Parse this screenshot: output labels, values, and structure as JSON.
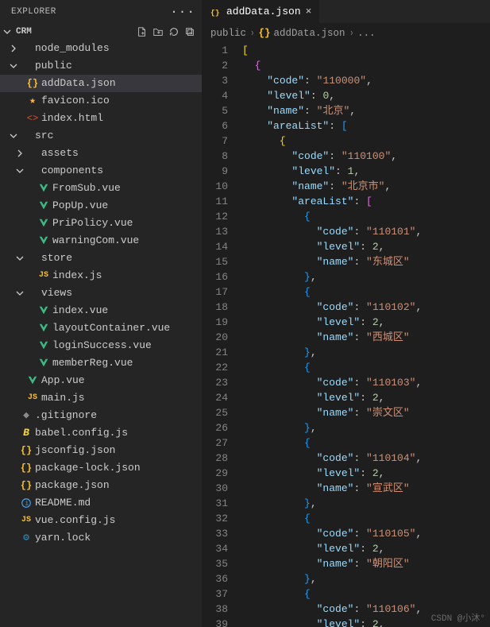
{
  "sidebar": {
    "title": "EXPLORER",
    "project": "CRM",
    "toolbar": {
      "new_file_icon": "new-file",
      "new_folder_icon": "new-folder",
      "refresh_icon": "refresh",
      "collapse_icon": "collapse-all"
    },
    "tree": [
      {
        "label": "node_modules",
        "type": "folder",
        "open": false,
        "depth": 0
      },
      {
        "label": "public",
        "type": "folder",
        "open": true,
        "depth": 0
      },
      {
        "label": "addData.json",
        "type": "file",
        "icon": "json",
        "depth": 1,
        "active": true
      },
      {
        "label": "favicon.ico",
        "type": "file",
        "icon": "ico",
        "depth": 1
      },
      {
        "label": "index.html",
        "type": "file",
        "icon": "html",
        "depth": 1
      },
      {
        "label": "src",
        "type": "folder",
        "open": true,
        "depth": 0
      },
      {
        "label": "assets",
        "type": "folder",
        "open": false,
        "depth": 1
      },
      {
        "label": "components",
        "type": "folder",
        "open": true,
        "depth": 1
      },
      {
        "label": "FromSub.vue",
        "type": "file",
        "icon": "vue",
        "depth": 2
      },
      {
        "label": "PopUp.vue",
        "type": "file",
        "icon": "vue",
        "depth": 2
      },
      {
        "label": "PriPolicy.vue",
        "type": "file",
        "icon": "vue",
        "depth": 2
      },
      {
        "label": "warningCom.vue",
        "type": "file",
        "icon": "vue",
        "depth": 2
      },
      {
        "label": "store",
        "type": "folder",
        "open": true,
        "depth": 1
      },
      {
        "label": "index.js",
        "type": "file",
        "icon": "js",
        "depth": 2
      },
      {
        "label": "views",
        "type": "folder",
        "open": true,
        "depth": 1
      },
      {
        "label": "index.vue",
        "type": "file",
        "icon": "vue",
        "depth": 2
      },
      {
        "label": "layoutContainer.vue",
        "type": "file",
        "icon": "vue",
        "depth": 2
      },
      {
        "label": "loginSuccess.vue",
        "type": "file",
        "icon": "vue",
        "depth": 2
      },
      {
        "label": "memberReg.vue",
        "type": "file",
        "icon": "vue",
        "depth": 2
      },
      {
        "label": "App.vue",
        "type": "file",
        "icon": "vue",
        "depth": 1
      },
      {
        "label": "main.js",
        "type": "file",
        "icon": "js",
        "depth": 1
      },
      {
        "label": ".gitignore",
        "type": "file",
        "icon": "git",
        "depth": 0
      },
      {
        "label": "babel.config.js",
        "type": "file",
        "icon": "babel",
        "depth": 0
      },
      {
        "label": "jsconfig.json",
        "type": "file",
        "icon": "json",
        "depth": 0
      },
      {
        "label": "package-lock.json",
        "type": "file",
        "icon": "json",
        "depth": 0
      },
      {
        "label": "package.json",
        "type": "file",
        "icon": "json",
        "depth": 0
      },
      {
        "label": "README.md",
        "type": "file",
        "icon": "info",
        "depth": 0
      },
      {
        "label": "vue.config.js",
        "type": "file",
        "icon": "js",
        "depth": 0
      },
      {
        "label": "yarn.lock",
        "type": "file",
        "icon": "yarn",
        "depth": 0
      }
    ]
  },
  "editor": {
    "tab": {
      "label": "addData.json",
      "icon": "json"
    },
    "breadcrumb": [
      "public",
      "addData.json",
      "..."
    ],
    "code": [
      [
        {
          "t": "[",
          "c": "bracket"
        }
      ],
      [
        {
          "t": "  "
        },
        {
          "t": "{",
          "c": "bracket-o"
        }
      ],
      [
        {
          "t": "    "
        },
        {
          "t": "\"code\"",
          "c": "key"
        },
        {
          "t": ": ",
          "c": "punc"
        },
        {
          "t": "\"110000\"",
          "c": "string"
        },
        {
          "t": ",",
          "c": "punc"
        }
      ],
      [
        {
          "t": "    "
        },
        {
          "t": "\"level\"",
          "c": "key"
        },
        {
          "t": ": ",
          "c": "punc"
        },
        {
          "t": "0",
          "c": "num"
        },
        {
          "t": ",",
          "c": "punc"
        }
      ],
      [
        {
          "t": "    "
        },
        {
          "t": "\"name\"",
          "c": "key"
        },
        {
          "t": ": ",
          "c": "punc"
        },
        {
          "t": "\"北京\"",
          "c": "string"
        },
        {
          "t": ",",
          "c": "punc"
        }
      ],
      [
        {
          "t": "    "
        },
        {
          "t": "\"areaList\"",
          "c": "key"
        },
        {
          "t": ": ",
          "c": "punc"
        },
        {
          "t": "[",
          "c": "bracket-b"
        }
      ],
      [
        {
          "t": "      "
        },
        {
          "t": "{",
          "c": "bracket"
        }
      ],
      [
        {
          "t": "        "
        },
        {
          "t": "\"code\"",
          "c": "key"
        },
        {
          "t": ": ",
          "c": "punc"
        },
        {
          "t": "\"110100\"",
          "c": "string"
        },
        {
          "t": ",",
          "c": "punc"
        }
      ],
      [
        {
          "t": "        "
        },
        {
          "t": "\"level\"",
          "c": "key"
        },
        {
          "t": ": ",
          "c": "punc"
        },
        {
          "t": "1",
          "c": "num"
        },
        {
          "t": ",",
          "c": "punc"
        }
      ],
      [
        {
          "t": "        "
        },
        {
          "t": "\"name\"",
          "c": "key"
        },
        {
          "t": ": ",
          "c": "punc"
        },
        {
          "t": "\"北京市\"",
          "c": "string"
        },
        {
          "t": ",",
          "c": "punc"
        }
      ],
      [
        {
          "t": "        "
        },
        {
          "t": "\"areaList\"",
          "c": "key"
        },
        {
          "t": ": ",
          "c": "punc"
        },
        {
          "t": "[",
          "c": "bracket-o"
        }
      ],
      [
        {
          "t": "          "
        },
        {
          "t": "{",
          "c": "bracket-b"
        }
      ],
      [
        {
          "t": "            "
        },
        {
          "t": "\"code\"",
          "c": "key"
        },
        {
          "t": ": ",
          "c": "punc"
        },
        {
          "t": "\"110101\"",
          "c": "string"
        },
        {
          "t": ",",
          "c": "punc"
        }
      ],
      [
        {
          "t": "            "
        },
        {
          "t": "\"level\"",
          "c": "key"
        },
        {
          "t": ": ",
          "c": "punc"
        },
        {
          "t": "2",
          "c": "num"
        },
        {
          "t": ",",
          "c": "punc"
        }
      ],
      [
        {
          "t": "            "
        },
        {
          "t": "\"name\"",
          "c": "key"
        },
        {
          "t": ": ",
          "c": "punc"
        },
        {
          "t": "\"东城区\"",
          "c": "string"
        }
      ],
      [
        {
          "t": "          "
        },
        {
          "t": "}",
          "c": "bracket-b"
        },
        {
          "t": ",",
          "c": "punc"
        }
      ],
      [
        {
          "t": "          "
        },
        {
          "t": "{",
          "c": "bracket-b"
        }
      ],
      [
        {
          "t": "            "
        },
        {
          "t": "\"code\"",
          "c": "key"
        },
        {
          "t": ": ",
          "c": "punc"
        },
        {
          "t": "\"110102\"",
          "c": "string"
        },
        {
          "t": ",",
          "c": "punc"
        }
      ],
      [
        {
          "t": "            "
        },
        {
          "t": "\"level\"",
          "c": "key"
        },
        {
          "t": ": ",
          "c": "punc"
        },
        {
          "t": "2",
          "c": "num"
        },
        {
          "t": ",",
          "c": "punc"
        }
      ],
      [
        {
          "t": "            "
        },
        {
          "t": "\"name\"",
          "c": "key"
        },
        {
          "t": ": ",
          "c": "punc"
        },
        {
          "t": "\"西城区\"",
          "c": "string"
        }
      ],
      [
        {
          "t": "          "
        },
        {
          "t": "}",
          "c": "bracket-b"
        },
        {
          "t": ",",
          "c": "punc"
        }
      ],
      [
        {
          "t": "          "
        },
        {
          "t": "{",
          "c": "bracket-b"
        }
      ],
      [
        {
          "t": "            "
        },
        {
          "t": "\"code\"",
          "c": "key"
        },
        {
          "t": ": ",
          "c": "punc"
        },
        {
          "t": "\"110103\"",
          "c": "string"
        },
        {
          "t": ",",
          "c": "punc"
        }
      ],
      [
        {
          "t": "            "
        },
        {
          "t": "\"level\"",
          "c": "key"
        },
        {
          "t": ": ",
          "c": "punc"
        },
        {
          "t": "2",
          "c": "num"
        },
        {
          "t": ",",
          "c": "punc"
        }
      ],
      [
        {
          "t": "            "
        },
        {
          "t": "\"name\"",
          "c": "key"
        },
        {
          "t": ": ",
          "c": "punc"
        },
        {
          "t": "\"崇文区\"",
          "c": "string"
        }
      ],
      [
        {
          "t": "          "
        },
        {
          "t": "}",
          "c": "bracket-b"
        },
        {
          "t": ",",
          "c": "punc"
        }
      ],
      [
        {
          "t": "          "
        },
        {
          "t": "{",
          "c": "bracket-b"
        }
      ],
      [
        {
          "t": "            "
        },
        {
          "t": "\"code\"",
          "c": "key"
        },
        {
          "t": ": ",
          "c": "punc"
        },
        {
          "t": "\"110104\"",
          "c": "string"
        },
        {
          "t": ",",
          "c": "punc"
        }
      ],
      [
        {
          "t": "            "
        },
        {
          "t": "\"level\"",
          "c": "key"
        },
        {
          "t": ": ",
          "c": "punc"
        },
        {
          "t": "2",
          "c": "num"
        },
        {
          "t": ",",
          "c": "punc"
        }
      ],
      [
        {
          "t": "            "
        },
        {
          "t": "\"name\"",
          "c": "key"
        },
        {
          "t": ": ",
          "c": "punc"
        },
        {
          "t": "\"宣武区\"",
          "c": "string"
        }
      ],
      [
        {
          "t": "          "
        },
        {
          "t": "}",
          "c": "bracket-b"
        },
        {
          "t": ",",
          "c": "punc"
        }
      ],
      [
        {
          "t": "          "
        },
        {
          "t": "{",
          "c": "bracket-b"
        }
      ],
      [
        {
          "t": "            "
        },
        {
          "t": "\"code\"",
          "c": "key"
        },
        {
          "t": ": ",
          "c": "punc"
        },
        {
          "t": "\"110105\"",
          "c": "string"
        },
        {
          "t": ",",
          "c": "punc"
        }
      ],
      [
        {
          "t": "            "
        },
        {
          "t": "\"level\"",
          "c": "key"
        },
        {
          "t": ": ",
          "c": "punc"
        },
        {
          "t": "2",
          "c": "num"
        },
        {
          "t": ",",
          "c": "punc"
        }
      ],
      [
        {
          "t": "            "
        },
        {
          "t": "\"name\"",
          "c": "key"
        },
        {
          "t": ": ",
          "c": "punc"
        },
        {
          "t": "\"朝阳区\"",
          "c": "string"
        }
      ],
      [
        {
          "t": "          "
        },
        {
          "t": "}",
          "c": "bracket-b"
        },
        {
          "t": ",",
          "c": "punc"
        }
      ],
      [
        {
          "t": "          "
        },
        {
          "t": "{",
          "c": "bracket-b"
        }
      ],
      [
        {
          "t": "            "
        },
        {
          "t": "\"code\"",
          "c": "key"
        },
        {
          "t": ": ",
          "c": "punc"
        },
        {
          "t": "\"110106\"",
          "c": "string"
        },
        {
          "t": ",",
          "c": "punc"
        }
      ],
      [
        {
          "t": "            "
        },
        {
          "t": "\"level\"",
          "c": "key"
        },
        {
          "t": ": ",
          "c": "punc"
        },
        {
          "t": "2",
          "c": "num"
        },
        {
          "t": ",",
          "c": "punc"
        }
      ]
    ]
  },
  "watermark": "CSDN @小沐°"
}
